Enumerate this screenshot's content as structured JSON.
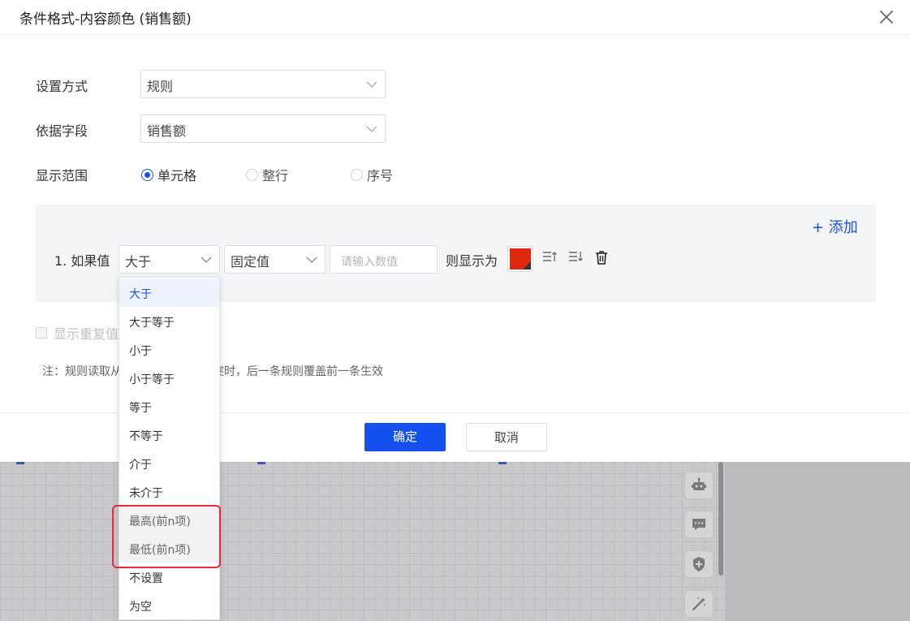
{
  "dialog": {
    "title": "条件格式-内容颜色 (销售额)",
    "close_icon": "close-icon"
  },
  "form": {
    "setting_mode": {
      "label": "设置方式",
      "value": "规则"
    },
    "based_field": {
      "label": "依据字段",
      "value": "销售额"
    },
    "display_scope": {
      "label": "显示范围",
      "options": [
        {
          "label": "单元格",
          "checked": true
        },
        {
          "label": "整行",
          "checked": false
        },
        {
          "label": "序号",
          "checked": false
        }
      ]
    }
  },
  "rules": {
    "add_label": "+ 添加",
    "items": [
      {
        "prefix": "1. 如果值",
        "operator": "大于",
        "value_type": "固定值",
        "value_placeholder": "请输入数值",
        "then_label": "则显示为",
        "color": "#e0280f"
      }
    ],
    "icons": [
      "sort-ascending-icon",
      "sort-descending-icon",
      "trash-icon"
    ]
  },
  "show_duplicate": {
    "label": "显示重复值",
    "checked": false
  },
  "note": "注：规则读取从上到下，规则间冲突时，后一条规则覆盖前一条生效",
  "footer": {
    "confirm": "确定",
    "cancel": "取消"
  },
  "operator_dropdown": {
    "options": [
      "大于",
      "大于等于",
      "小于",
      "小于等于",
      "等于",
      "不等于",
      "介于",
      "未介于",
      "最高(前n项)",
      "最低(前n项)",
      "不设置",
      "为空"
    ],
    "selected": "大于",
    "highlighted": [
      "最高(前n项)",
      "最低(前n项)"
    ]
  },
  "background_tools": [
    "robot-icon",
    "chat-icon",
    "shield-plus-icon",
    "magic-wand-icon"
  ],
  "colors": {
    "primary": "#1450f0",
    "highlight_border": "#e8283c"
  }
}
